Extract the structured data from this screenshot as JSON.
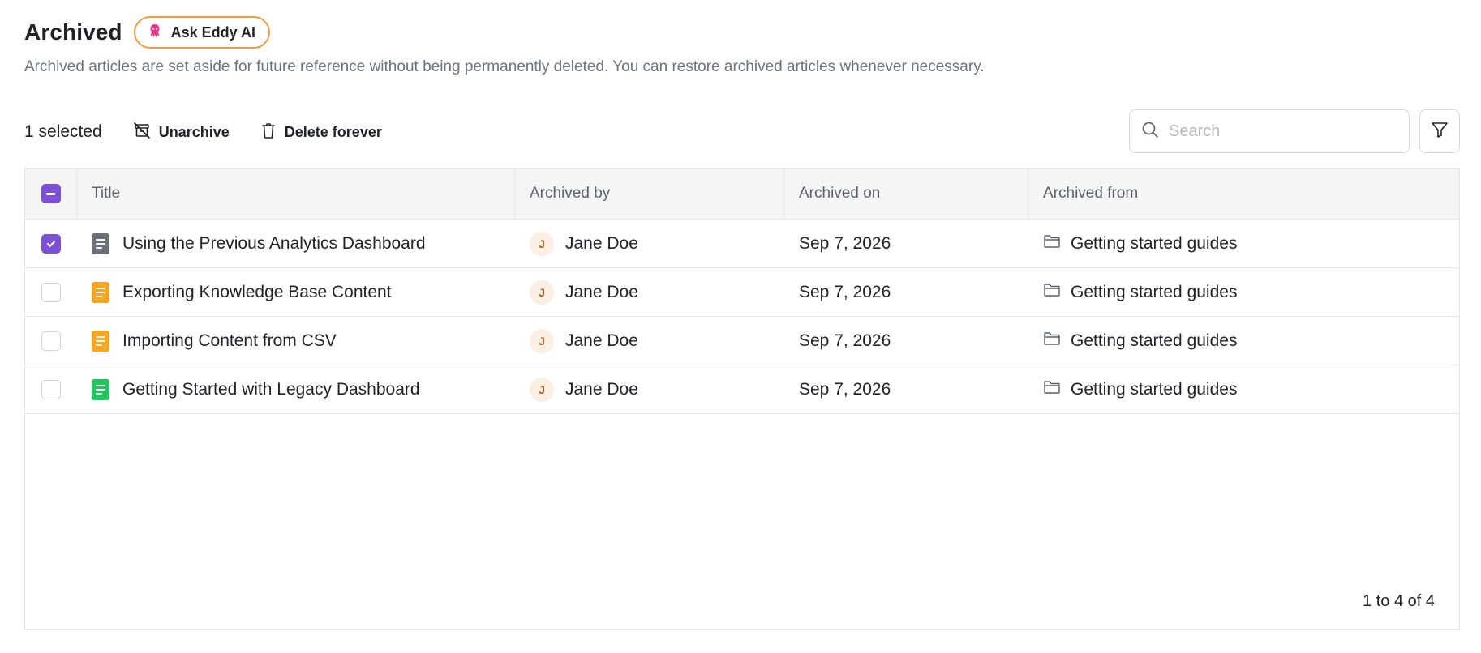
{
  "page": {
    "title": "Archived",
    "ask_ai_label": "Ask Eddy AI",
    "description": "Archived articles are set aside for future reference without being permanently deleted. You can restore archived articles whenever necessary."
  },
  "toolbar": {
    "selected_text": "1 selected",
    "unarchive_label": "Unarchive",
    "delete_label": "Delete forever"
  },
  "search": {
    "placeholder": "Search",
    "value": ""
  },
  "table": {
    "columns": [
      "Title",
      "Archived by",
      "Archived on",
      "Archived from"
    ],
    "rows": [
      {
        "title": "Using the Previous Analytics Dashboard",
        "icon_color": "#6b7078",
        "archived_by": "Jane Doe",
        "avatar_initial": "J",
        "archived_on": "Sep 7, 2026",
        "archived_from": "Getting started guides",
        "selected": true
      },
      {
        "title": "Exporting Knowledge Base Content",
        "icon_color": "#f5a623",
        "archived_by": "Jane Doe",
        "avatar_initial": "J",
        "archived_on": "Sep 7, 2026",
        "archived_from": "Getting started guides",
        "selected": false
      },
      {
        "title": "Importing Content from CSV",
        "icon_color": "#f5a623",
        "archived_by": "Jane Doe",
        "avatar_initial": "J",
        "archived_on": "Sep 7, 2026",
        "archived_from": "Getting started guides",
        "selected": false
      },
      {
        "title": "Getting Started with Legacy Dashboard",
        "icon_color": "#22c55e",
        "archived_by": "Jane Doe",
        "avatar_initial": "J",
        "archived_on": "Sep 7, 2026",
        "archived_from": "Getting started guides",
        "selected": false
      }
    ]
  },
  "pagination": {
    "text": "1 to 4 of 4"
  },
  "colors": {
    "accent": "#7b4fd6",
    "ask_ai_border": "#f59a3e",
    "ask_ai_icon": "#e8368f"
  },
  "icons": {
    "ask_ai": "octopus-icon",
    "unarchive": "unarchive-icon",
    "delete": "trash-icon",
    "search": "search-icon",
    "filter": "filter-icon",
    "folder": "folder-icon",
    "document": "document-icon"
  }
}
